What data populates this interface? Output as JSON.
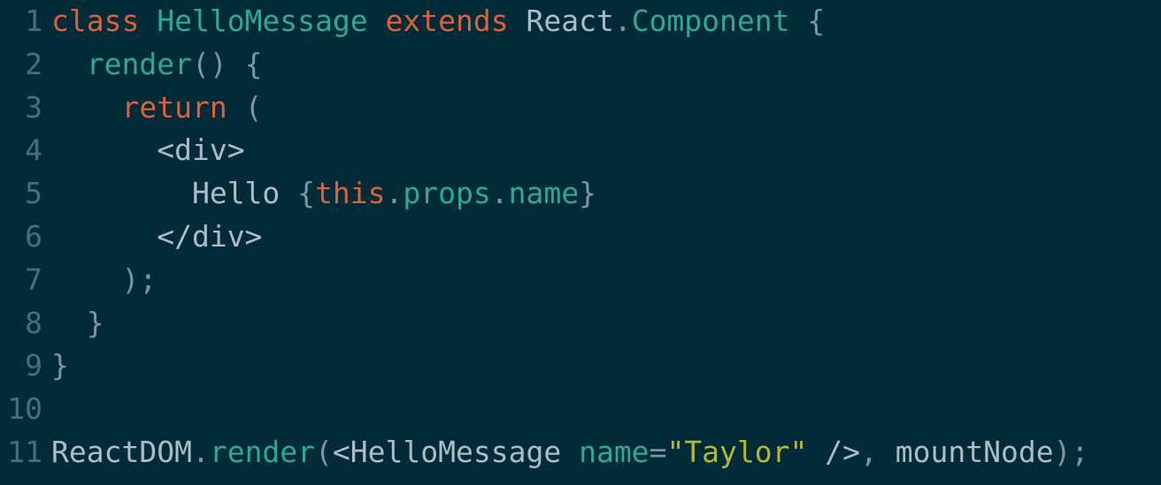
{
  "editor": {
    "lines": [
      {
        "num": "1",
        "tokens": [
          {
            "t": "class",
            "c": "keyword"
          },
          {
            "t": " ",
            "c": "plain"
          },
          {
            "t": "HelloMessage",
            "c": "class"
          },
          {
            "t": " ",
            "c": "plain"
          },
          {
            "t": "extends",
            "c": "keyword"
          },
          {
            "t": " ",
            "c": "plain"
          },
          {
            "t": "React",
            "c": "plain"
          },
          {
            "t": ".",
            "c": "punc"
          },
          {
            "t": "Component",
            "c": "class"
          },
          {
            "t": " ",
            "c": "plain"
          },
          {
            "t": "{",
            "c": "punc"
          }
        ]
      },
      {
        "num": "2",
        "tokens": [
          {
            "t": "  ",
            "c": "plain"
          },
          {
            "t": "render",
            "c": "func"
          },
          {
            "t": "() {",
            "c": "punc"
          }
        ]
      },
      {
        "num": "3",
        "tokens": [
          {
            "t": "    ",
            "c": "plain"
          },
          {
            "t": "return",
            "c": "keyword"
          },
          {
            "t": " (",
            "c": "punc"
          }
        ]
      },
      {
        "num": "4",
        "tokens": [
          {
            "t": "      ",
            "c": "plain"
          },
          {
            "t": "<div>",
            "c": "tag"
          }
        ]
      },
      {
        "num": "5",
        "tokens": [
          {
            "t": "        ",
            "c": "plain"
          },
          {
            "t": "Hello ",
            "c": "plain"
          },
          {
            "t": "{",
            "c": "punc"
          },
          {
            "t": "this",
            "c": "this"
          },
          {
            "t": ".",
            "c": "punc"
          },
          {
            "t": "props",
            "c": "prop"
          },
          {
            "t": ".",
            "c": "punc"
          },
          {
            "t": "name",
            "c": "prop"
          },
          {
            "t": "}",
            "c": "punc"
          }
        ]
      },
      {
        "num": "6",
        "tokens": [
          {
            "t": "      ",
            "c": "plain"
          },
          {
            "t": "</div>",
            "c": "tag"
          }
        ]
      },
      {
        "num": "7",
        "tokens": [
          {
            "t": "    ",
            "c": "plain"
          },
          {
            "t": ");",
            "c": "punc"
          }
        ]
      },
      {
        "num": "8",
        "tokens": [
          {
            "t": "  ",
            "c": "plain"
          },
          {
            "t": "}",
            "c": "punc"
          }
        ]
      },
      {
        "num": "9",
        "tokens": [
          {
            "t": "}",
            "c": "punc"
          }
        ]
      },
      {
        "num": "10",
        "tokens": []
      },
      {
        "num": "11",
        "tokens": [
          {
            "t": "ReactDOM",
            "c": "plain"
          },
          {
            "t": ".",
            "c": "punc"
          },
          {
            "t": "render",
            "c": "func"
          },
          {
            "t": "(",
            "c": "punc"
          },
          {
            "t": "<HelloMessage",
            "c": "tag"
          },
          {
            "t": " ",
            "c": "plain"
          },
          {
            "t": "name",
            "c": "attr"
          },
          {
            "t": "=",
            "c": "punc"
          },
          {
            "t": "\"Taylor\"",
            "c": "string"
          },
          {
            "t": " ",
            "c": "plain"
          },
          {
            "t": "/>",
            "c": "tag"
          },
          {
            "t": ", ",
            "c": "punc"
          },
          {
            "t": "mountNode",
            "c": "plain"
          },
          {
            "t": ");",
            "c": "punc"
          }
        ]
      }
    ]
  },
  "colors": {
    "background": "#022b3a",
    "line_number": "#4c6c7a",
    "keyword": "#d9623a",
    "type": "#2fa89a",
    "string": "#b8b72b",
    "text": "#aebcc3"
  }
}
